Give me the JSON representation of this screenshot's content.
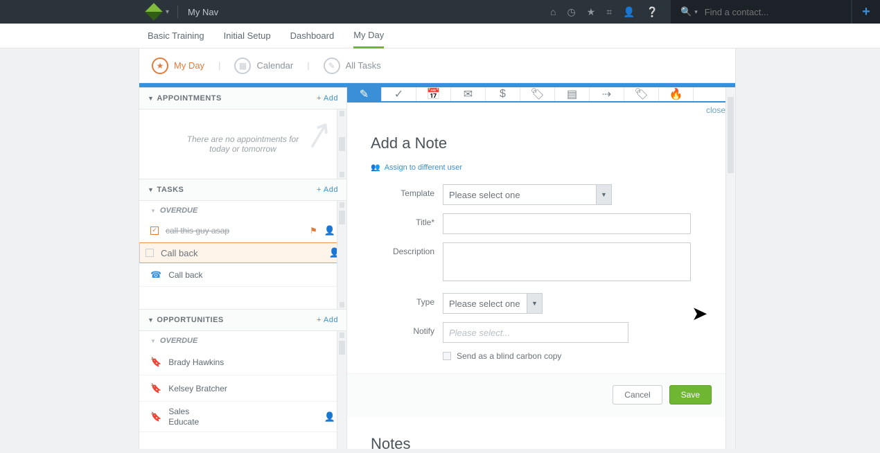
{
  "topbar": {
    "brand": "My Nav",
    "search_placeholder": "Find a contact..."
  },
  "nav": {
    "tabs": [
      "Basic Training",
      "Initial Setup",
      "Dashboard",
      "My Day"
    ],
    "active_index": 3
  },
  "subtabs": {
    "items": [
      "My Day",
      "Calendar",
      "All Tasks"
    ],
    "active_index": 0
  },
  "appointments": {
    "title": "APPOINTMENTS",
    "add_label": "+ Add",
    "empty_text": "There are no appointments for today or tomorrow"
  },
  "tasks": {
    "title": "TASKS",
    "add_label": "+ Add",
    "overdue_label": "OVERDUE",
    "items": [
      {
        "label": "call this guy asap",
        "checked": true,
        "flagged": true,
        "type": "check",
        "done": true
      },
      {
        "label": "Call back",
        "checked": false,
        "selected": true,
        "type": "check"
      },
      {
        "label": "Call back",
        "type": "phone"
      }
    ]
  },
  "opportunities": {
    "title": "OPPORTUNITIES",
    "add_label": "+ Add",
    "overdue_label": "OVERDUE",
    "items": [
      {
        "label": "Brady Hawkins"
      },
      {
        "label": "Kelsey Bratcher"
      },
      {
        "label": "Sales\nEducate",
        "person": true
      }
    ]
  },
  "form": {
    "title": "Add a Note",
    "assign_link": "Assign to different user",
    "template_label": "Template",
    "template_value": "Please select one",
    "title_label": "Title*",
    "desc_label": "Description",
    "type_label": "Type",
    "type_value": "Please select one",
    "notify_label": "Notify",
    "notify_placeholder": "Please select...",
    "bcc_label": "Send as a blind carbon copy",
    "cancel": "Cancel",
    "save": "Save",
    "close": "close"
  },
  "notes": {
    "heading": "Notes"
  }
}
